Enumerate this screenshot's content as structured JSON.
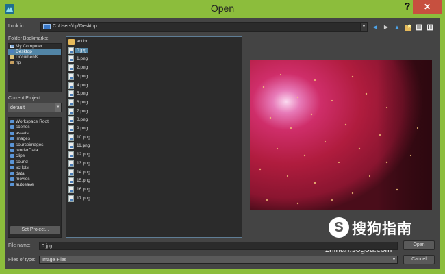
{
  "window": {
    "title": "Open",
    "help_glyph": "?",
    "close_glyph": "✕",
    "titlebar_color": "#8cbd3c"
  },
  "look_in": {
    "label": "Look in:",
    "value": "C:\\Users\\hp\\Desktop"
  },
  "bookmarks": {
    "label": "Folder Bookmarks:",
    "items": [
      {
        "label": "My Computer",
        "icon": "computer-icon"
      },
      {
        "label": "Desktop",
        "icon": "desktop-icon",
        "selected": true
      },
      {
        "label": "Documents",
        "icon": "documents-icon"
      },
      {
        "label": "hp",
        "icon": "user-folder-icon"
      }
    ]
  },
  "current_project": {
    "label": "Current Project:",
    "value": "default",
    "folders": [
      "Workspace Root",
      "scenes",
      "assets",
      "images",
      "sourceimages",
      "renderData",
      "clips",
      "sound",
      "scripts",
      "data",
      "movies",
      "autosave"
    ],
    "set_button": "Set Project..."
  },
  "files": [
    {
      "name": "action",
      "type": "folder"
    },
    {
      "name": "0.jpg",
      "type": "image",
      "selected": true
    },
    {
      "name": "1.png",
      "type": "image"
    },
    {
      "name": "2.png",
      "type": "image"
    },
    {
      "name": "3.png",
      "type": "image"
    },
    {
      "name": "4.png",
      "type": "image"
    },
    {
      "name": "5.png",
      "type": "image"
    },
    {
      "name": "6.png",
      "type": "image"
    },
    {
      "name": "7.png",
      "type": "image"
    },
    {
      "name": "8.png",
      "type": "image"
    },
    {
      "name": "9.png",
      "type": "image"
    },
    {
      "name": "10.png",
      "type": "image"
    },
    {
      "name": "11.png",
      "type": "image"
    },
    {
      "name": "12.png",
      "type": "image"
    },
    {
      "name": "13.png",
      "type": "image"
    },
    {
      "name": "14.png",
      "type": "image"
    },
    {
      "name": "15.png",
      "type": "image"
    },
    {
      "name": "16.png",
      "type": "image"
    },
    {
      "name": "17.png",
      "type": "image"
    }
  ],
  "file_name": {
    "label": "File name:",
    "value": "0.jpg"
  },
  "file_type": {
    "label": "Files of type:",
    "value": "Image Files"
  },
  "buttons": {
    "open": "Open",
    "cancel": "Cancel"
  },
  "watermark": {
    "logo": "S",
    "brand": "搜狗指南",
    "url": "zhinan.sogou.com"
  }
}
